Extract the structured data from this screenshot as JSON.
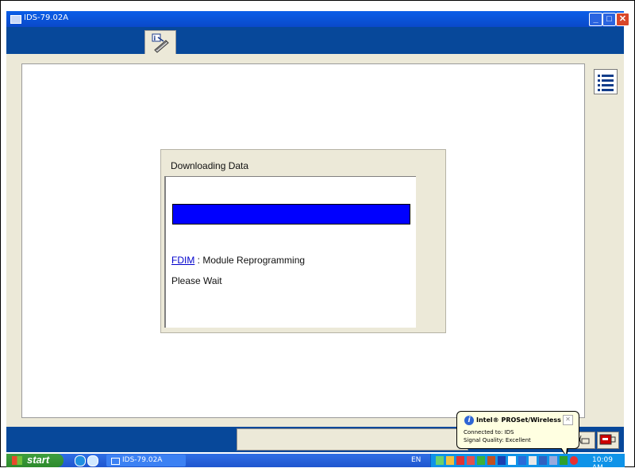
{
  "window": {
    "title": "IDS-79.02A",
    "minimize_label": "_",
    "maximize_label": "□",
    "close_label": "✕"
  },
  "toolbar": {
    "active_tab_icon": "info-tools-icon"
  },
  "dialog": {
    "title": "Downloading Data",
    "progress_percent": 100,
    "module_link": "FDIM",
    "module_text": " : Module Reprogramming",
    "wait_text": "Please Wait"
  },
  "statusbar": {
    "field_value": ""
  },
  "taskbar": {
    "start_label": "start",
    "task_label": "IDS-79.02A",
    "language": "EN",
    "clock": "10:09 AM"
  },
  "balloon": {
    "title": "Intel® PROSet/Wireless",
    "line1": "Connected to: IDS",
    "line2": "Signal Quality: Excellent"
  },
  "colors": {
    "progress_fill": "#0000ff",
    "title_bar": "#0a5ee8",
    "band": "#07489a"
  }
}
